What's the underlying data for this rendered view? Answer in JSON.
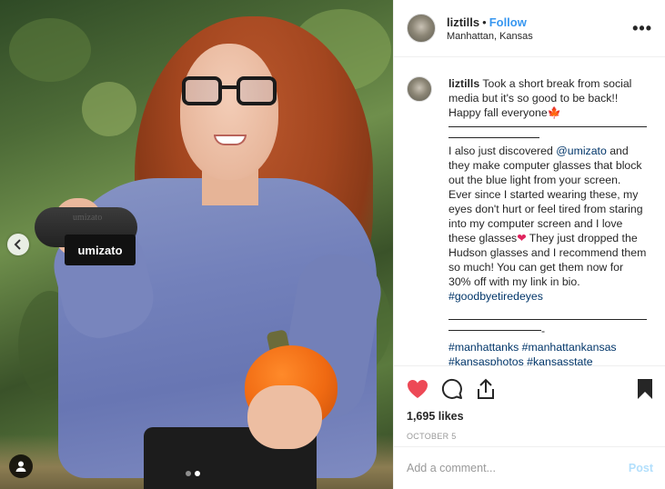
{
  "post": {
    "image_tag_label": "umizato",
    "case_brand_text": "umizato",
    "carousel": {
      "total": 2,
      "active": 2
    }
  },
  "header": {
    "username": "liztills",
    "separator": "•",
    "follow_label": "Follow",
    "location": "Manhattan, Kansas",
    "more_label": "•••"
  },
  "caption": {
    "username": "liztills",
    "intro": "Took a short break from social media but it's so good to be back!! Happy fall everyone",
    "leaf_emoji": "🍁",
    "p1_before": "I also just discovered ",
    "mention": "@umizato",
    "p1_after": " and they make computer glasses that block out the blue light from your screen. Ever since I started wearing these, my eyes don't hurt or feel tired from staring into my computer screen and I love these glasses",
    "heart_emoji": "❤",
    "p1_end": " They just dropped the Hudson glasses and I recommend them so much! You can get them now for 30% off with my link in bio. ",
    "hashtag_main": "#goodbyetiredeyes",
    "dash_end": "-",
    "hashtags": [
      "#manhattanks",
      "#manhattankansas",
      "#kansasphotos",
      "#kansasstate"
    ]
  },
  "actions": {
    "likes": "1,695 likes",
    "date": "OCTOBER 5"
  },
  "comment": {
    "placeholder": "Add a comment...",
    "post_label": "Post"
  },
  "colors": {
    "link_blue": "#3897f0",
    "like_red": "#ed4956",
    "post_disabled": "#b2dffc"
  },
  "icons": [
    "chevron-left-icon",
    "user-tag-icon",
    "heart-icon",
    "comment-icon",
    "share-icon",
    "bookmark-icon",
    "more-options-icon"
  ]
}
